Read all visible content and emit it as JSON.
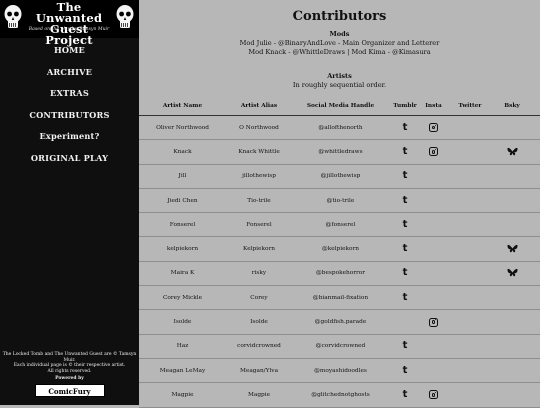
{
  "sidebar": {
    "title_line1": "The Unwanted",
    "title_line2": "Guest Project",
    "subtitle": "Based on the play by Tamsyn Muir",
    "nav": [
      {
        "label": "HOME"
      },
      {
        "label": "ARCHIVE"
      },
      {
        "label": "EXTRAS"
      },
      {
        "label": "CONTRIBUTORS"
      },
      {
        "label": "Experiment?"
      },
      {
        "label": "ORIGINAL PLAY"
      }
    ],
    "footer_line1": "The Locked Tomb and The Unwanted Guest are © Tamsyn Muir.",
    "footer_line2": "Each individual page is © their respective artist.",
    "footer_line3": "All rights reserved.",
    "powered_by": "Powered by",
    "powered_badge": "ComicFury"
  },
  "main": {
    "title": "Contributors",
    "mods_heading": "Mods",
    "mods_line1": "Mod Julie - @BinaryAndLove - Main Organizer and Letterer",
    "mods_line2": "Mod Knack - @WhittleDraws  |  Mod Kima - @Kimasura",
    "artists_heading": "Artists",
    "artists_note": "In roughly sequential order.",
    "columns": [
      "Artist Name",
      "Artist Alias",
      "Social Media Handle",
      "Tumblr",
      "Insta",
      "Twitter",
      "Bsky"
    ],
    "artists": [
      {
        "name": "Oliver Northwood",
        "alias": "O Northwood",
        "handle": "@allofthenorth",
        "tumblr": true,
        "insta": true,
        "twitter": false,
        "bsky": false
      },
      {
        "name": "Knack",
        "alias": "Knack Whittle",
        "handle": "@whittledraws",
        "tumblr": true,
        "insta": true,
        "twitter": false,
        "bsky": true
      },
      {
        "name": "Jill",
        "alias": "jillothewisp",
        "handle": "@jillothewisp",
        "tumblr": true,
        "insta": false,
        "twitter": false,
        "bsky": false
      },
      {
        "name": "Jiedi Chen",
        "alias": "Tio-trile",
        "handle": "@tio-trile",
        "tumblr": true,
        "insta": false,
        "twitter": false,
        "bsky": false
      },
      {
        "name": "Fonserel",
        "alias": "Fonserel",
        "handle": "@fonserel",
        "tumblr": true,
        "insta": false,
        "twitter": false,
        "bsky": false
      },
      {
        "name": "kelpiekorn",
        "alias": "Kelpiekorn",
        "handle": "@kelpiekorn",
        "tumblr": true,
        "insta": false,
        "twitter": false,
        "bsky": true
      },
      {
        "name": "Maira K",
        "alias": "risky",
        "handle": "@bespokehorror",
        "tumblr": true,
        "insta": false,
        "twitter": false,
        "bsky": true
      },
      {
        "name": "Corey Mickle",
        "alias": "Corey",
        "handle": "@bianmail-fixation",
        "tumblr": true,
        "insta": false,
        "twitter": false,
        "bsky": false
      },
      {
        "name": "Isolde",
        "alias": "Isolde",
        "handle": "@goldfish.parade",
        "tumblr": false,
        "insta": true,
        "twitter": false,
        "bsky": false
      },
      {
        "name": "Haz",
        "alias": "corvidcrowned",
        "handle": "@corvidcrowned",
        "tumblr": true,
        "insta": false,
        "twitter": false,
        "bsky": false
      },
      {
        "name": "Meagan LeMay",
        "alias": "Meagan/Ylva",
        "handle": "@moyashidoodles",
        "tumblr": true,
        "insta": false,
        "twitter": false,
        "bsky": false
      },
      {
        "name": "Magpie",
        "alias": "Magpie",
        "handle": "@glitchednotghosts",
        "tumblr": true,
        "insta": true,
        "twitter": false,
        "bsky": false
      }
    ]
  }
}
